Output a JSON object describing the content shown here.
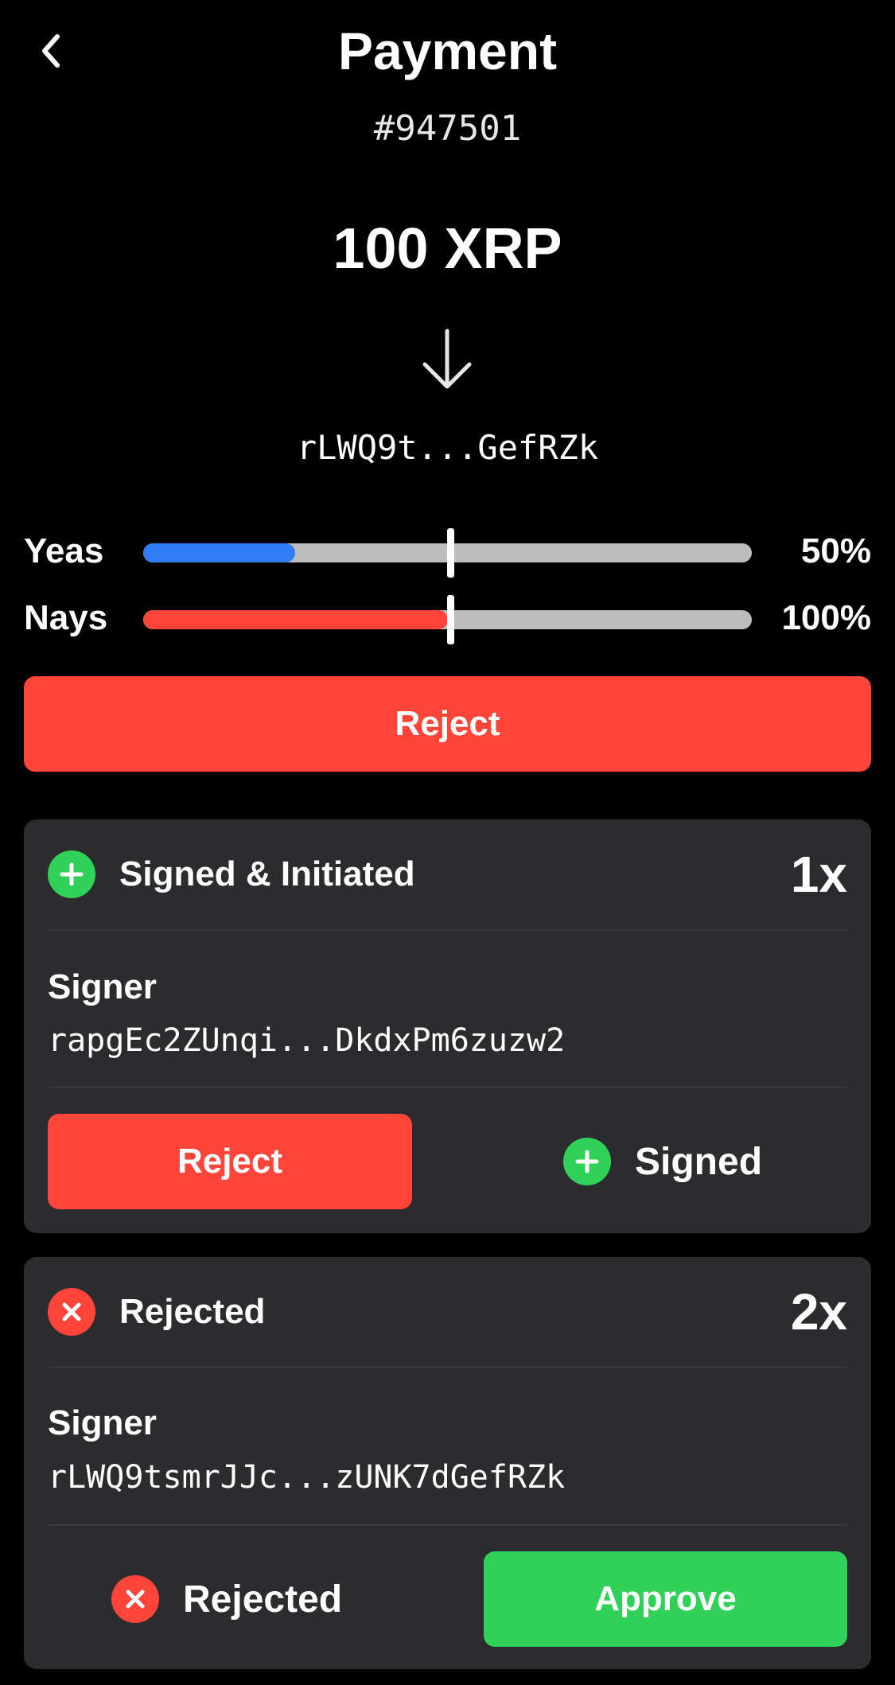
{
  "header": {
    "title": "Payment",
    "tx_id": "#947501"
  },
  "transfer": {
    "amount": "100 XRP",
    "destination": "rLWQ9t...GefRZk"
  },
  "votes": {
    "yeas": {
      "label": "Yeas",
      "percent_text": "50%",
      "fill_fraction": 0.25,
      "color": "#2f7cf6"
    },
    "nays": {
      "label": "Nays",
      "percent_text": "100%",
      "fill_fraction": 0.5,
      "color": "#ff453a"
    },
    "threshold_fraction": 0.5
  },
  "actions": {
    "reject_label": "Reject"
  },
  "cards": [
    {
      "status": "Signed & Initiated",
      "status_icon": "plus-circle-icon",
      "count": "1x",
      "signer_label": "Signer",
      "signer_address": "rapgEc2ZUnqi...DkdxPm6zuzw2",
      "action_label": "Reject",
      "state_label": "Signed",
      "state_icon": "plus-circle-icon"
    },
    {
      "status": "Rejected",
      "status_icon": "x-circle-icon",
      "count": "2x",
      "signer_label": "Signer",
      "signer_address": "rLWQ9tsmrJJc...zUNK7dGefRZk",
      "state_label": "Rejected",
      "state_icon": "x-circle-icon",
      "action_label": "Approve"
    }
  ],
  "colors": {
    "accent_red": "#ff453a",
    "accent_green": "#30d158",
    "accent_blue": "#2f7cf6",
    "card_bg": "#2c2c2e"
  }
}
